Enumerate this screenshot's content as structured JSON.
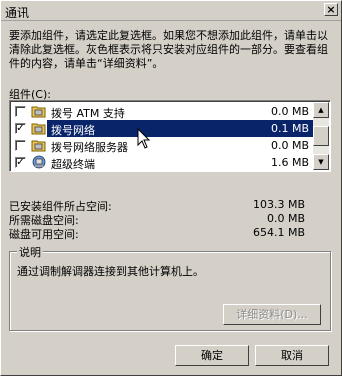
{
  "window": {
    "title": "通讯",
    "close_glyph": "×"
  },
  "intro_text": "要添加组件，请选定此复选框。如果您不想添加此组件，请单击以清除此复选框。灰色框表示将只安装对应组件的一部分。要查看组件的内容，请单击“详细资料”。",
  "components": {
    "label": "组件(C):",
    "items": [
      {
        "name": "拨号 ATM 支持",
        "size": "0.0 MB",
        "checked": false,
        "selected": false,
        "icon": "folder-network-icon"
      },
      {
        "name": "拨号网络",
        "size": "0.1 MB",
        "checked": true,
        "selected": true,
        "icon": "folder-network-icon"
      },
      {
        "name": "拨号网络服务器",
        "size": "0.0 MB",
        "checked": false,
        "selected": false,
        "icon": "folder-network-icon"
      },
      {
        "name": "超级终端",
        "size": "1.6 MB",
        "checked": true,
        "selected": false,
        "icon": "hyperterminal-icon"
      }
    ]
  },
  "stats": {
    "installed_label": "已安装组件所占空间:",
    "installed_value": "103.3 MB",
    "required_label": "所需磁盘空间:",
    "required_value": "0.0 MB",
    "available_label": "磁盘可用空间:",
    "available_value": "654.1 MB"
  },
  "description": {
    "group_title": "说明",
    "text": "通过调制解调器连接到其他计算机上。"
  },
  "buttons": {
    "details": "详细资料(D)...",
    "ok": "确定",
    "cancel": "取消"
  }
}
